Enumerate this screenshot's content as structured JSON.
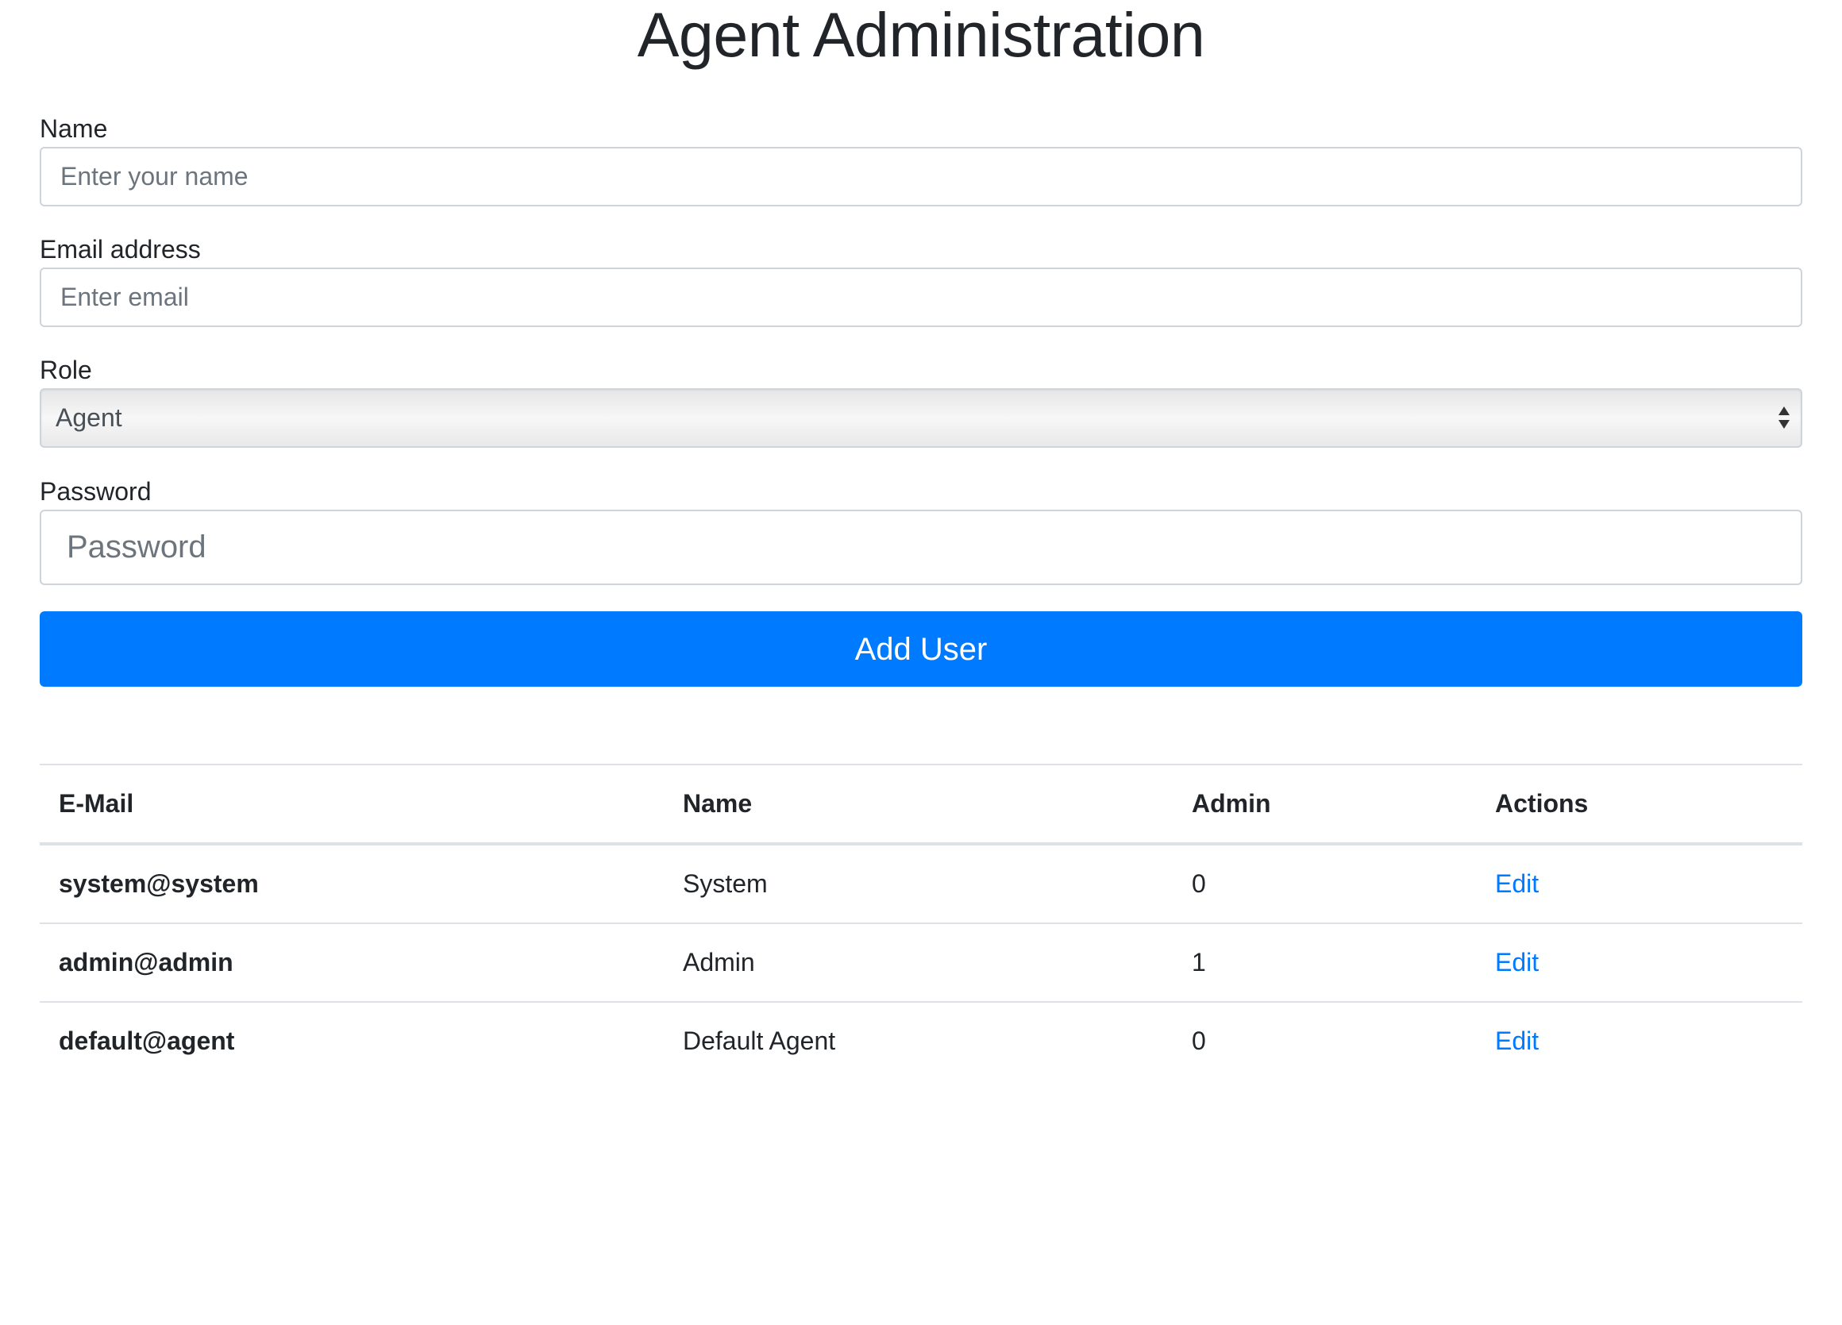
{
  "header": {
    "title": "Agent Administration"
  },
  "form": {
    "name": {
      "label": "Name",
      "placeholder": "Enter your name",
      "value": ""
    },
    "email": {
      "label": "Email address",
      "placeholder": "Enter email",
      "value": ""
    },
    "role": {
      "label": "Role",
      "selected": "Agent"
    },
    "password": {
      "label": "Password",
      "placeholder": "Password",
      "value": ""
    },
    "submit_label": "Add User"
  },
  "table": {
    "columns": [
      "E-Mail",
      "Name",
      "Admin",
      "Actions"
    ],
    "rows": [
      {
        "email": "system@system",
        "name": "System",
        "admin": "0",
        "action": "Edit"
      },
      {
        "email": "admin@admin",
        "name": "Admin",
        "admin": "1",
        "action": "Edit"
      },
      {
        "email": "default@agent",
        "name": "Default Agent",
        "admin": "0",
        "action": "Edit"
      }
    ]
  },
  "colors": {
    "primary": "#007bff",
    "text": "#212529",
    "border": "#dee2e6",
    "input_border": "#ced4da",
    "placeholder": "#6c757d"
  }
}
